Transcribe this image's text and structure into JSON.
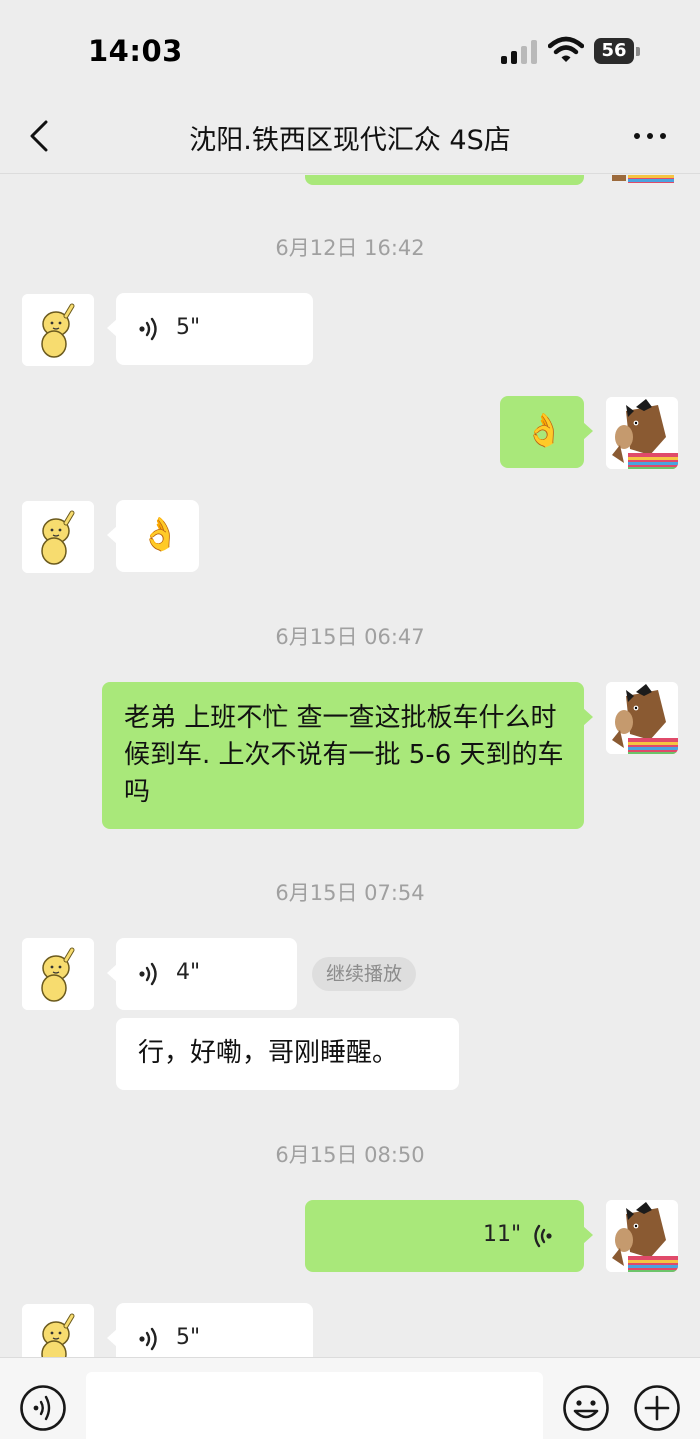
{
  "status_bar": {
    "time": "14:03",
    "battery": "56"
  },
  "nav": {
    "title": "沈阳.铁西区现代汇众 4S店"
  },
  "messages": {
    "ts1": "6月12日 16:42",
    "m1_voice_duration": "5\"",
    "m2_emoji": "👌",
    "m3_emoji": "👌",
    "ts2": "6月15日 06:47",
    "m4_text": "老弟 上班不忙 查一查这批板车什么时候到车. 上次不说有一批 5-6 天到的车吗",
    "ts3": "6月15日 07:54",
    "m5_voice_duration": "4\"",
    "m5_continue_label": "继续播放",
    "m6_text": "行，好嘞，哥刚睡醒。",
    "ts4": "6月15日 08:50",
    "m7_voice_duration": "11\"",
    "m8_voice_duration": "5\""
  },
  "colors": {
    "background": "#ededed",
    "outgoing_bubble": "#a9e87a",
    "incoming_bubble": "#ffffff",
    "timestamp": "#a0a0a0"
  },
  "icons": [
    "back-chevron-icon",
    "more-dots-icon",
    "voice-wave-icon",
    "emoji-smile-icon",
    "plus-circle-icon",
    "cellular-signal-icon",
    "wifi-icon",
    "battery-icon"
  ]
}
